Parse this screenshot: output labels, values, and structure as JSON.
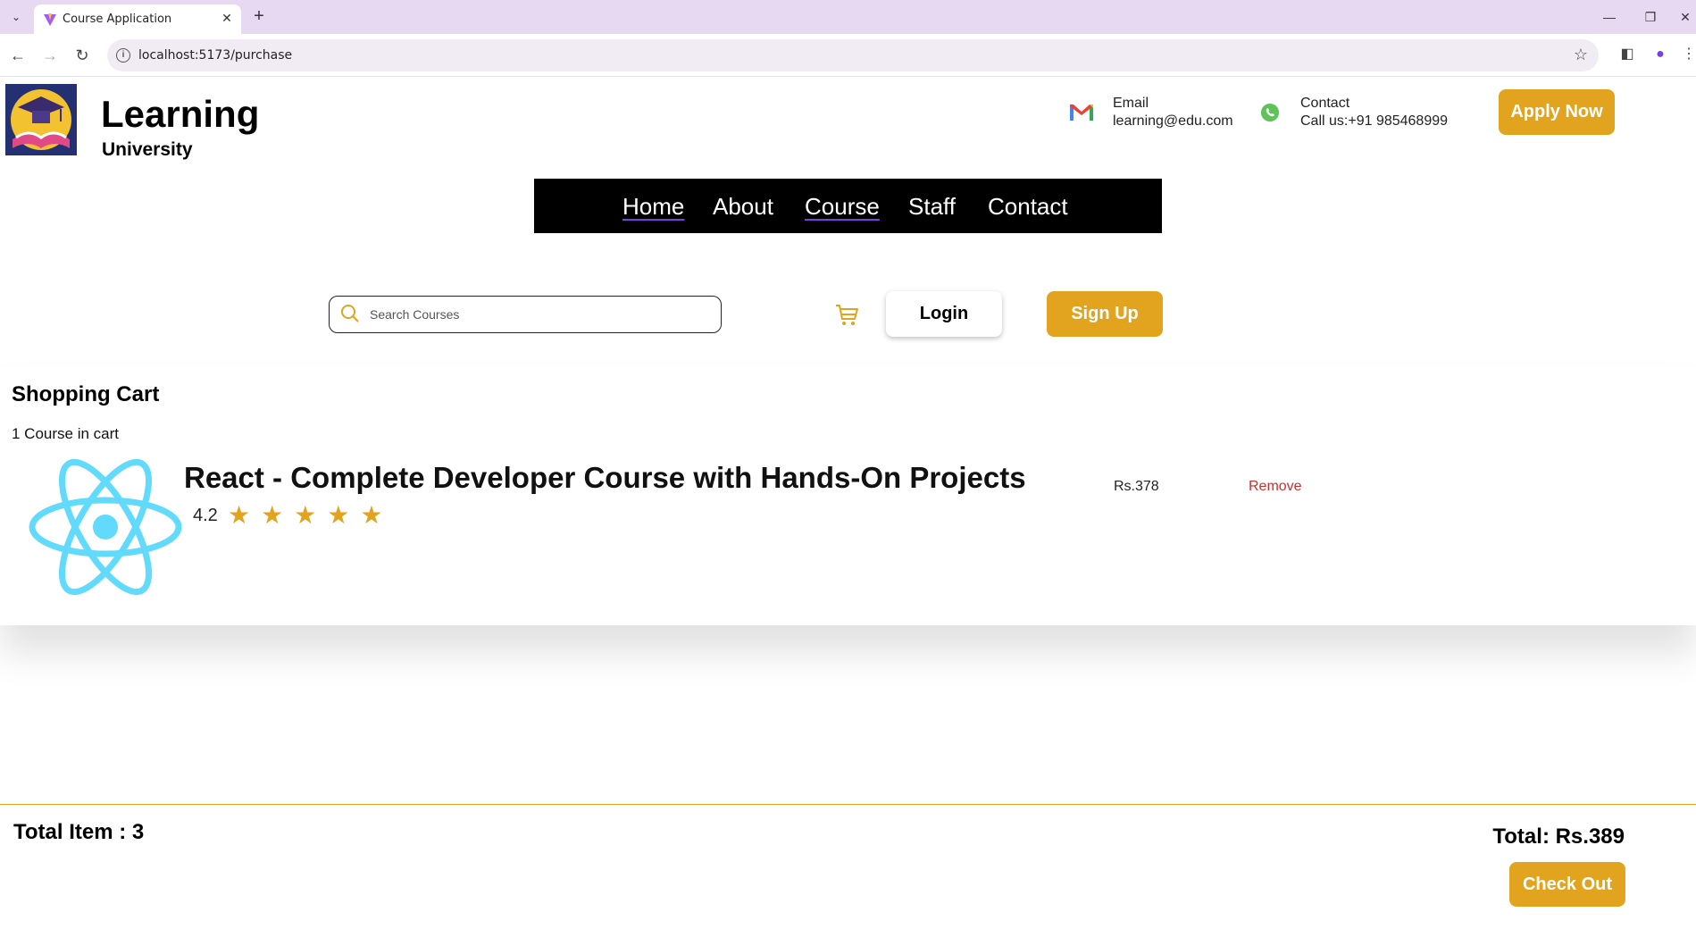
{
  "browser": {
    "tab_title": "Course Application",
    "url": "localhost:5173/purchase"
  },
  "header": {
    "brand_name": "Learning",
    "brand_sub": "University",
    "email_label": "Email",
    "email_value": "learning@edu.com",
    "contact_label": "Contact",
    "contact_value": "Call us:+91 985468999",
    "apply_label": "Apply Now"
  },
  "nav": {
    "items": [
      {
        "label": "Home"
      },
      {
        "label": "About"
      },
      {
        "label": "Course"
      },
      {
        "label": "Staff"
      },
      {
        "label": "Contact"
      }
    ]
  },
  "search": {
    "placeholder": "Search Courses"
  },
  "auth": {
    "login_label": "Login",
    "signup_label": "Sign Up"
  },
  "cart": {
    "title": "Shopping Cart",
    "count_text": "1 Course in cart",
    "items": [
      {
        "title": "React - Complete Developer Course with Hands-On Projects",
        "rating": "4.2",
        "stars": "★★★★★",
        "price": "Rs.378",
        "remove_label": "Remove"
      }
    ]
  },
  "summary": {
    "total_items": "Total Item : 3",
    "total_price": "Total: Rs.389",
    "checkout_label": "Check Out"
  },
  "colors": {
    "accent": "#e2a41f",
    "nav_bg": "#000000",
    "remove": "#c9302c",
    "react": "#61dafb"
  }
}
